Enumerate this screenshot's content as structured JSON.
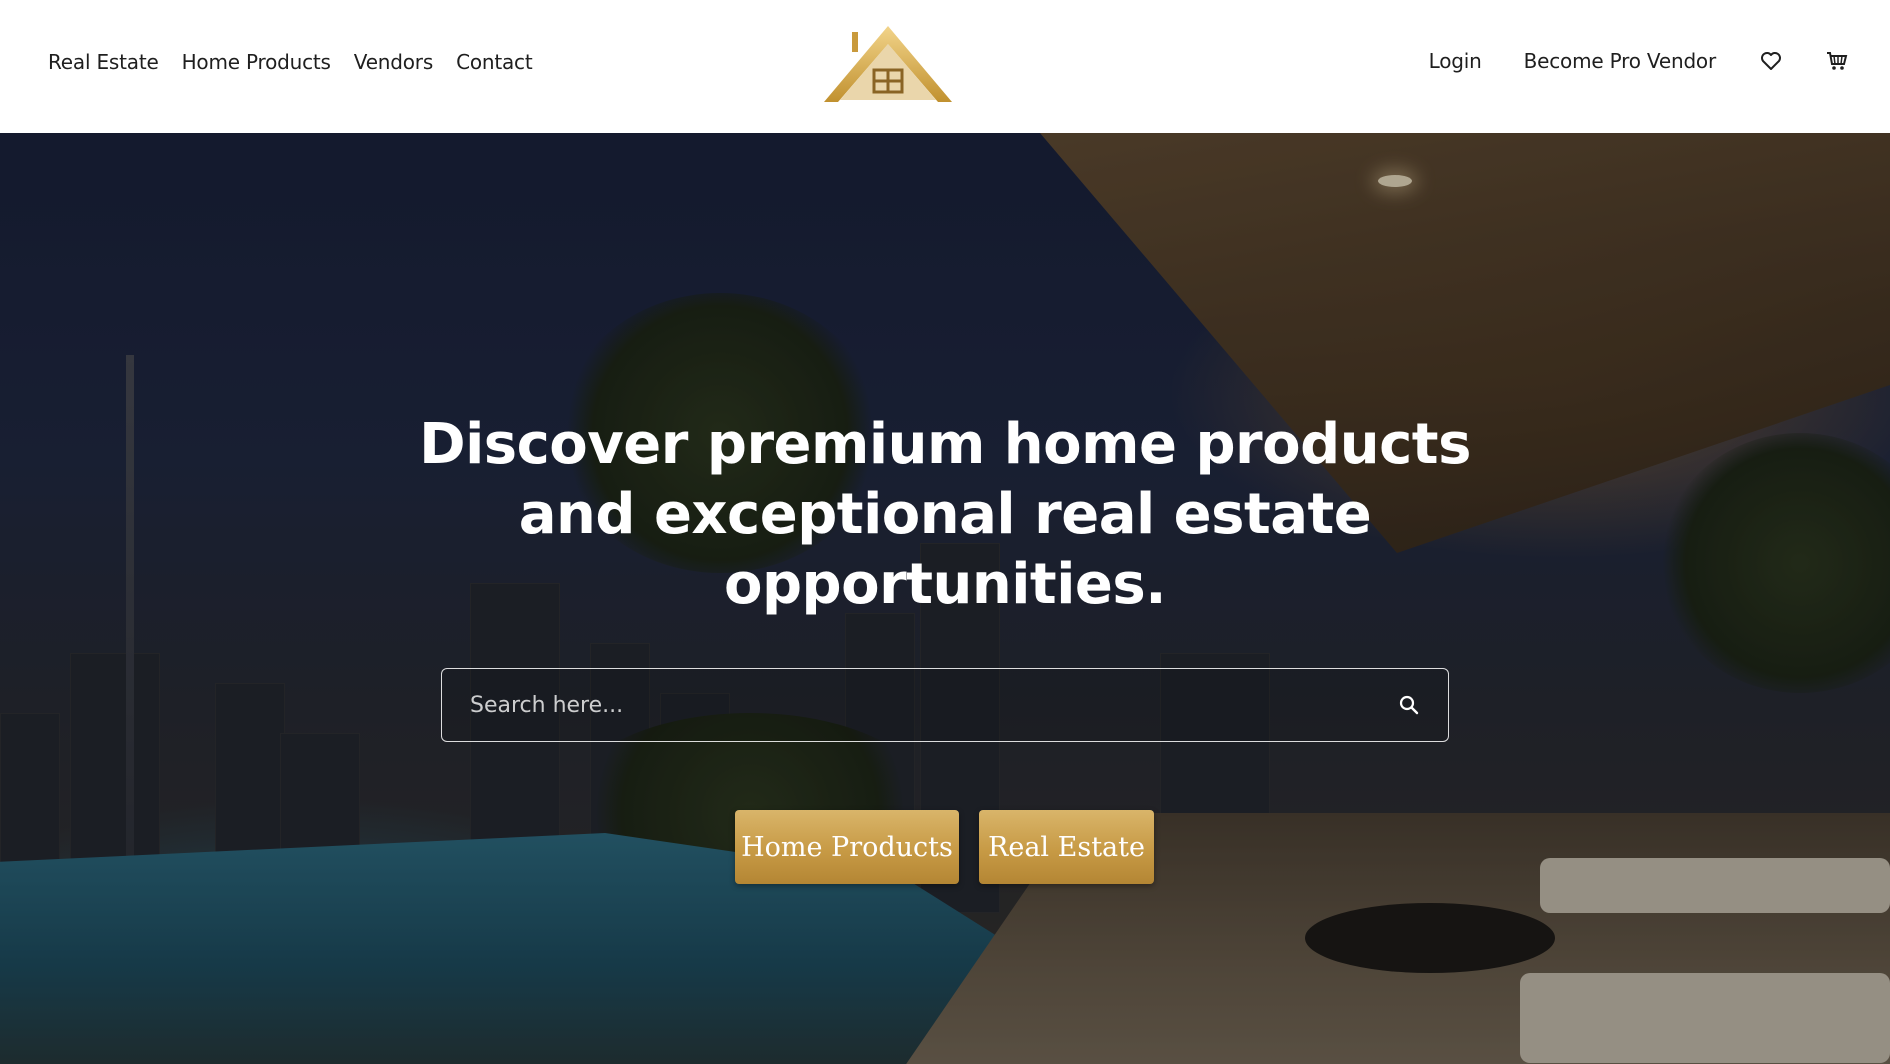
{
  "header": {
    "nav_left": [
      {
        "label": "Real Estate"
      },
      {
        "label": "Home Products"
      },
      {
        "label": "Vendors"
      },
      {
        "label": "Contact"
      }
    ],
    "nav_right": {
      "login_label": "Login",
      "vendor_label": "Become Pro Vendor",
      "wishlist_icon": "heart-icon",
      "cart_icon": "cart-icon"
    },
    "logo_icon": "house-roof-logo"
  },
  "hero": {
    "title": "Discover premium home products and exceptional real estate opportunities.",
    "search": {
      "placeholder": "Search here...",
      "value": ""
    },
    "buttons": {
      "home_products": "Home Products",
      "real_estate": "Real Estate"
    }
  },
  "colors": {
    "gold": "#c79a45",
    "gold_light": "#d9b56a",
    "text_dark": "#1f1f1f"
  }
}
